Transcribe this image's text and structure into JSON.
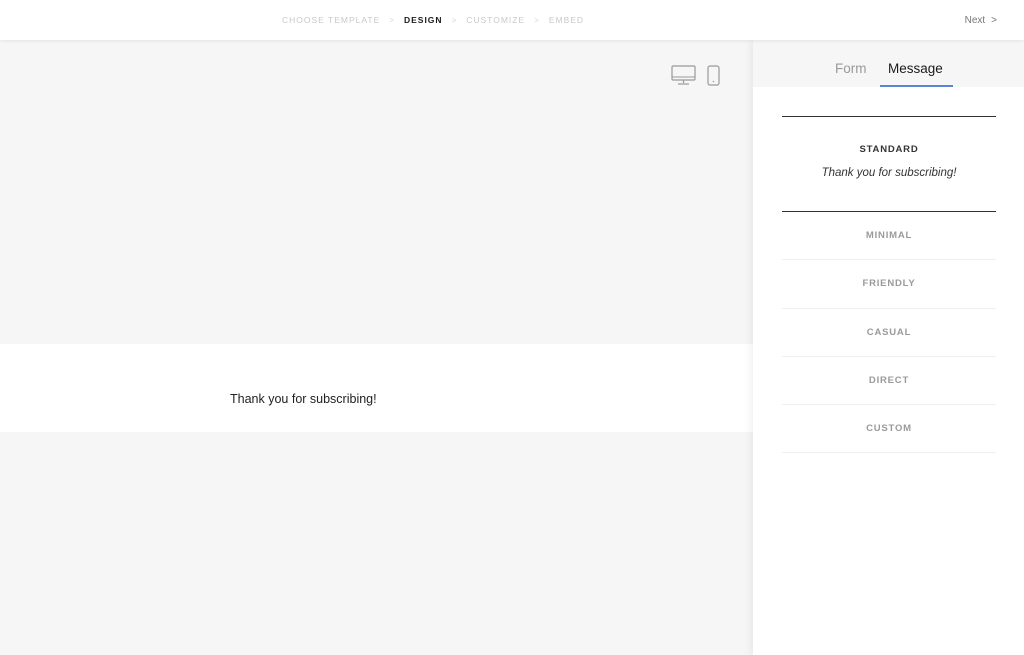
{
  "steps": [
    "CHOOSE TEMPLATE",
    "DESIGN",
    "CUSTOMIZE",
    "EMBED"
  ],
  "step_separator": ">",
  "active_step": "DESIGN",
  "next": {
    "label": "Next",
    "chevron": ">"
  },
  "device_toggles": [
    {
      "icon": "desktop-icon"
    },
    {
      "icon": "mobile-icon"
    }
  ],
  "preview": {
    "message": "Thank you for subscribing!"
  },
  "panel": {
    "tabs": [
      "Form",
      "Message"
    ],
    "active_tab": "Message",
    "selected_option": {
      "title": "STANDARD",
      "preview": "Thank you for subscribing!"
    },
    "options": [
      "MINIMAL",
      "FRIENDLY",
      "CASUAL",
      "DIRECT",
      "CUSTOM"
    ]
  },
  "colors": {
    "accent": "#5b84d6",
    "background": "#f6f6f6"
  }
}
